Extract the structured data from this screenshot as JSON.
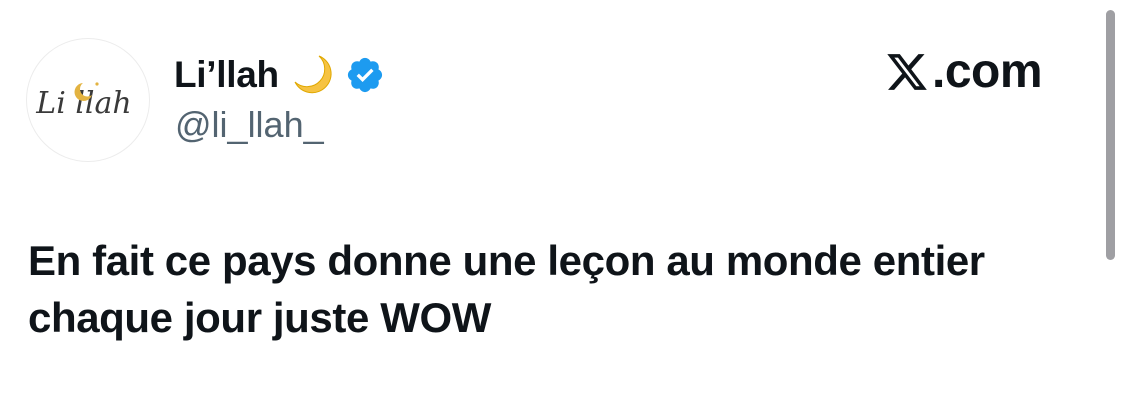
{
  "tweet": {
    "author": {
      "display_name": "Li’llah",
      "handle": "@li_llah_",
      "avatar_text": "Li llah",
      "name_emoji_icon": "crescent-moon-icon",
      "verified_icon": "verified-badge-icon",
      "verified_color": "#1d9bf0"
    },
    "brand": {
      "icon": "x-logo-icon",
      "text": ".com"
    },
    "text": "En fait ce pays donne une leçon au monde entier chaque jour juste WOW"
  },
  "colors": {
    "text_primary": "#0f1419",
    "text_secondary": "#536471",
    "moon": "#f6c342",
    "avatar_star": "#e3b341"
  }
}
